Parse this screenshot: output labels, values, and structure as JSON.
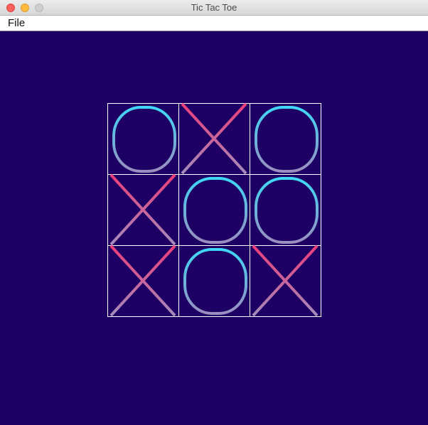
{
  "window": {
    "title": "Tic Tac Toe"
  },
  "menu": {
    "file_label": "File"
  },
  "board": {
    "cells": [
      "O",
      "X",
      "O",
      "X",
      "O",
      "O",
      "X",
      "O",
      "X"
    ]
  },
  "colors": {
    "background": "#1e0064",
    "grid": "#ffffff",
    "o_top": "#3fd8f5",
    "o_bottom": "#9a8ec0",
    "x_top": "#ee3d7a",
    "x_bottom": "#a48cbc"
  }
}
